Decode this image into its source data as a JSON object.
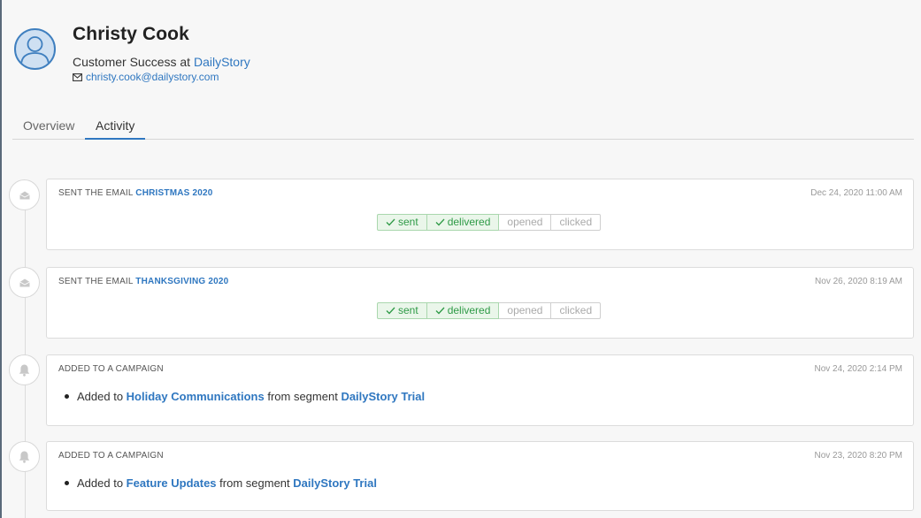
{
  "profile": {
    "name": "Christy Cook",
    "role_prefix": "Customer Success at",
    "company": "DailyStory",
    "email": "christy.cook@dailystory.com"
  },
  "tabs": [
    {
      "label": "Overview",
      "active": false
    },
    {
      "label": "Activity",
      "active": true
    }
  ],
  "events": [
    {
      "type": "email",
      "icon": "envelope-icon",
      "title_prefix": "SENT THE EMAIL",
      "title_emph": "CHRISTMAS 2020",
      "date": "Dec 24, 2020 11:00 AM",
      "steps": [
        {
          "label": "sent",
          "done": true
        },
        {
          "label": "delivered",
          "done": true
        },
        {
          "label": "opened",
          "done": false
        },
        {
          "label": "clicked",
          "done": false
        }
      ]
    },
    {
      "type": "email",
      "icon": "envelope-icon",
      "title_prefix": "SENT THE EMAIL",
      "title_emph": "THANKSGIVING 2020",
      "date": "Nov 26, 2020 8:19 AM",
      "steps": [
        {
          "label": "sent",
          "done": true
        },
        {
          "label": "delivered",
          "done": true
        },
        {
          "label": "opened",
          "done": false
        },
        {
          "label": "clicked",
          "done": false
        }
      ]
    },
    {
      "type": "campaign",
      "icon": "bell-icon",
      "title_prefix": "ADDED TO A CAMPAIGN",
      "date": "Nov 24, 2020 2:14 PM",
      "added_to": "Added to",
      "campaign": "Holiday Communications",
      "from_segment": "from segment",
      "segment": "DailyStory Trial"
    },
    {
      "type": "campaign",
      "icon": "bell-icon",
      "title_prefix": "ADDED TO A CAMPAIGN",
      "date": "Nov 23, 2020 8:20 PM",
      "added_to": "Added to",
      "campaign": "Feature Updates",
      "from_segment": "from segment",
      "segment": "DailyStory Trial"
    }
  ],
  "colors": {
    "accent": "#2f77c0",
    "done_green": "#2e9a46"
  }
}
